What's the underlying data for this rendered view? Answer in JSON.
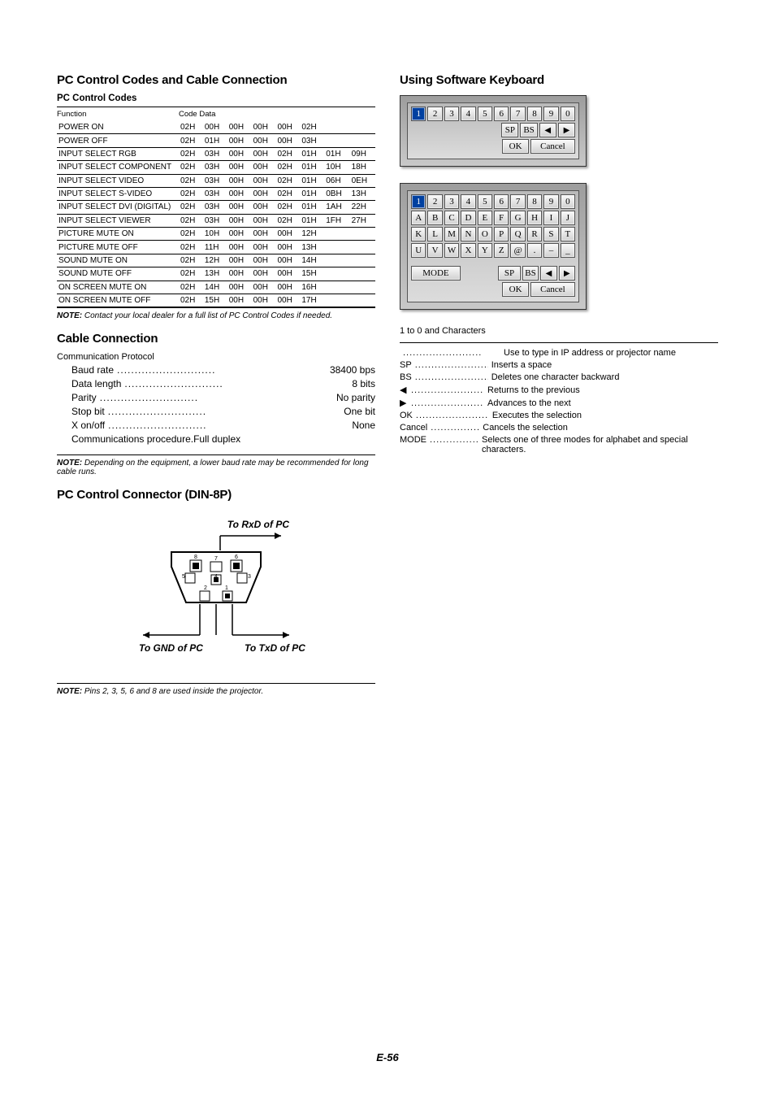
{
  "left": {
    "h1": "PC Control Codes and Cable Connection",
    "h2a": "PC Control Codes",
    "table": {
      "headers": [
        "Function",
        "Code Data"
      ],
      "rows": [
        {
          "fn": "POWER ON",
          "codes": [
            "02H",
            "00H",
            "00H",
            "00H",
            "00H",
            "02H",
            "",
            ""
          ]
        },
        {
          "fn": "POWER OFF",
          "codes": [
            "02H",
            "01H",
            "00H",
            "00H",
            "00H",
            "03H",
            "",
            ""
          ]
        },
        {
          "fn": "INPUT SELECT RGB",
          "codes": [
            "02H",
            "03H",
            "00H",
            "00H",
            "02H",
            "01H",
            "01H",
            "09H"
          ]
        },
        {
          "fn": "INPUT SELECT COMPONENT",
          "codes": [
            "02H",
            "03H",
            "00H",
            "00H",
            "02H",
            "01H",
            "10H",
            "18H"
          ]
        },
        {
          "fn": "INPUT SELECT VIDEO",
          "codes": [
            "02H",
            "03H",
            "00H",
            "00H",
            "02H",
            "01H",
            "06H",
            "0EH"
          ]
        },
        {
          "fn": "INPUT SELECT S-VIDEO",
          "codes": [
            "02H",
            "03H",
            "00H",
            "00H",
            "02H",
            "01H",
            "0BH",
            "13H"
          ]
        },
        {
          "fn": "INPUT SELECT DVI (DIGITAL)",
          "codes": [
            "02H",
            "03H",
            "00H",
            "00H",
            "02H",
            "01H",
            "1AH",
            "22H"
          ]
        },
        {
          "fn": "INPUT SELECT VIEWER",
          "codes": [
            "02H",
            "03H",
            "00H",
            "00H",
            "02H",
            "01H",
            "1FH",
            "27H"
          ]
        },
        {
          "fn": "PICTURE MUTE ON",
          "codes": [
            "02H",
            "10H",
            "00H",
            "00H",
            "00H",
            "12H",
            "",
            ""
          ]
        },
        {
          "fn": "PICTURE MUTE OFF",
          "codes": [
            "02H",
            "11H",
            "00H",
            "00H",
            "00H",
            "13H",
            "",
            ""
          ]
        },
        {
          "fn": "SOUND MUTE ON",
          "codes": [
            "02H",
            "12H",
            "00H",
            "00H",
            "00H",
            "14H",
            "",
            ""
          ]
        },
        {
          "fn": "SOUND MUTE OFF",
          "codes": [
            "02H",
            "13H",
            "00H",
            "00H",
            "00H",
            "15H",
            "",
            ""
          ]
        },
        {
          "fn": "ON SCREEN MUTE ON",
          "codes": [
            "02H",
            "14H",
            "00H",
            "00H",
            "00H",
            "16H",
            "",
            ""
          ]
        },
        {
          "fn": "ON SCREEN MUTE OFF",
          "codes": [
            "02H",
            "15H",
            "00H",
            "00H",
            "00H",
            "17H",
            "",
            ""
          ]
        }
      ]
    },
    "note1_b": "NOTE:",
    "note1": " Contact your local dealer for a full list of PC Control Codes if needed.",
    "h1b": "Cable Connection",
    "comm_title": "Communication Protocol",
    "comm": [
      {
        "label": "Baud rate",
        "value": "38400 bps"
      },
      {
        "label": "Data length",
        "value": "8 bits"
      },
      {
        "label": "Parity",
        "value": "No parity"
      },
      {
        "label": "Stop bit",
        "value": "One bit"
      },
      {
        "label": "X on/off",
        "value": "None"
      },
      {
        "label": "Communications procedure",
        "value": "Full duplex"
      }
    ],
    "note2_b": "NOTE:",
    "note2": " Depending on the equipment, a lower baud rate may be recommended for long cable runs.",
    "h1c": "PC Control Connector (DIN-8P)",
    "svg": {
      "rxd": "To RxD of PC",
      "gnd": "To GND of PC",
      "txd": "To TxD of PC"
    },
    "note3_b": "NOTE:",
    "note3": " Pins 2, 3, 5, 6 and 8 are used inside the projector."
  },
  "right": {
    "h1": "Using Software Keyboard",
    "kbd1_active": "1",
    "kbd1_row1": [
      "1",
      "2",
      "3",
      "4",
      "5",
      "6",
      "7",
      "8",
      "9",
      "0"
    ],
    "kbd1_row2": {
      "sp": "SP",
      "bs": "BS",
      "left": "◀",
      "right": "▶"
    },
    "kbd1_row3": {
      "ok": "OK",
      "cancel": "Cancel"
    },
    "kbd2_row1": [
      "1",
      "2",
      "3",
      "4",
      "5",
      "6",
      "7",
      "8",
      "9",
      "0"
    ],
    "kbd2_alpha": [
      [
        "A",
        "B",
        "C",
        "D",
        "E",
        "F",
        "G",
        "H",
        "I",
        "J"
      ],
      [
        "K",
        "L",
        "M",
        "N",
        "O",
        "P",
        "Q",
        "R",
        "S",
        "T"
      ],
      [
        "U",
        "V",
        "W",
        "X",
        "Y",
        "Z",
        "@",
        ".",
        "–",
        "_"
      ]
    ],
    "kbd2_row5": {
      "mode": "MODE",
      "sp": "SP",
      "bs": "BS",
      "left": "◀",
      "right": "▶"
    },
    "kbd2_row6": {
      "ok": "OK",
      "cancel": "Cancel"
    },
    "legend_title": "1 to 0 and Characters",
    "legend": [
      {
        "key": "",
        "desc": "Use to type in IP address or projector name"
      },
      {
        "key": "SP",
        "desc": "Inserts a space"
      },
      {
        "key": "BS",
        "desc": "Deletes one character backward"
      },
      {
        "key": "◀",
        "desc": "Returns to the previous"
      },
      {
        "key": "▶",
        "desc": "Advances to the next"
      },
      {
        "key": "OK",
        "desc": "Executes the selection"
      },
      {
        "key": "Cancel",
        "desc": "Cancels the selection"
      },
      {
        "key": "MODE",
        "desc": "Selects one of three modes for alphabet and special characters."
      }
    ]
  },
  "page": "E-56"
}
